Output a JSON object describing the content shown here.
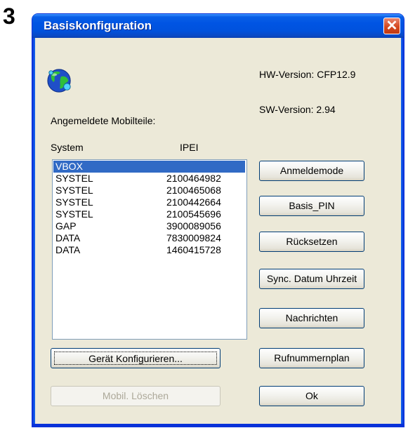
{
  "step_number": "3",
  "window": {
    "title": "Basiskonfiguration",
    "close_label": "✕"
  },
  "hw_version": "HW-Version: CFP12.9",
  "sw_version": "SW-Version: 2.94",
  "registered_label": "Angemeldete Mobilteile:",
  "columns": {
    "system": "System",
    "ipei": "IPEI"
  },
  "rows": [
    {
      "system": "VBOX",
      "ipei": ""
    },
    {
      "system": "SYSTEL",
      "ipei": "2100464982"
    },
    {
      "system": "SYSTEL",
      "ipei": "2100465068"
    },
    {
      "system": "SYSTEL",
      "ipei": "2100442664"
    },
    {
      "system": "SYSTEL",
      "ipei": "2100545696"
    },
    {
      "system": "GAP",
      "ipei": "3900089056"
    },
    {
      "system": "DATA",
      "ipei": "7830009824"
    },
    {
      "system": "DATA",
      "ipei": "1460415728"
    }
  ],
  "buttons": {
    "configure": "Gerät Konfigurieren...",
    "delete": "Mobil. Löschen",
    "register_mode": "Anmeldemode",
    "base_pin": "Basis_PIN",
    "reset": "Rücksetzen",
    "sync": "Sync. Datum Uhrzeit",
    "messages": "Nachrichten",
    "dial_plan": "Rufnummernplan",
    "ok": "Ok"
  },
  "icons": {
    "globe": "globe-icon"
  },
  "colors": {
    "titlebar": "#0054e3",
    "selection": "#316ac5",
    "dialog_bg": "#ece9d8"
  }
}
